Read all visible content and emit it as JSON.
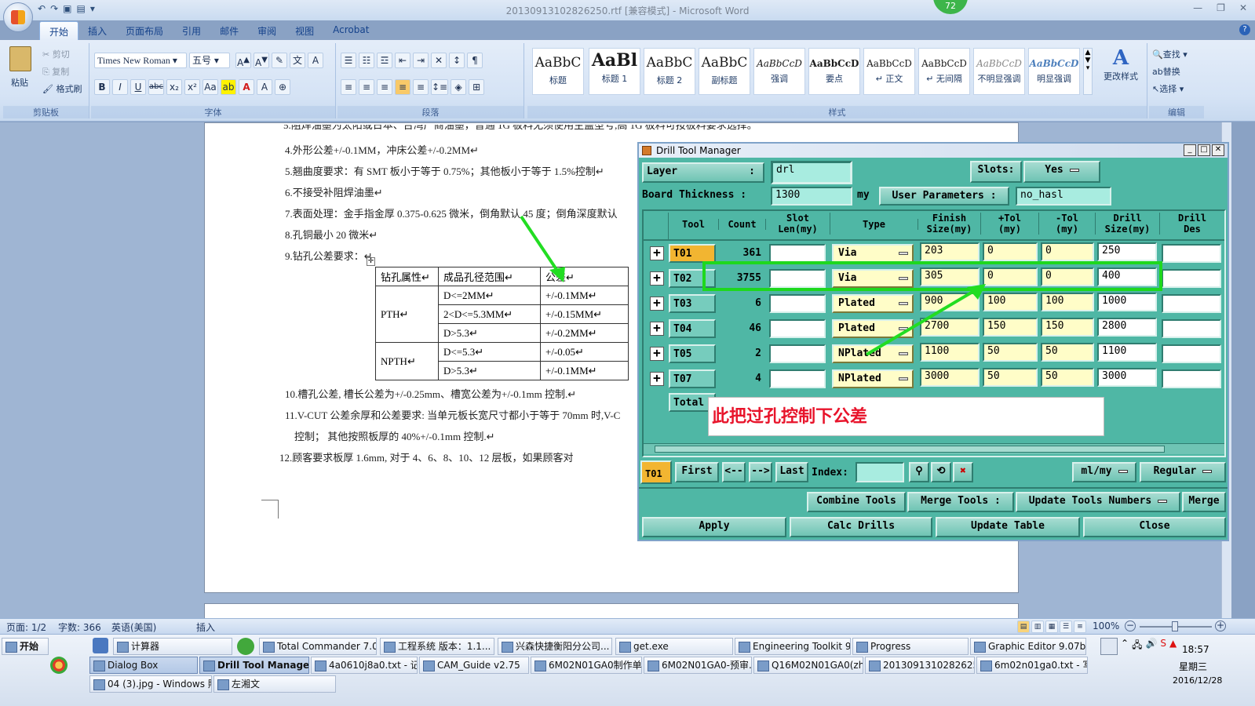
{
  "word": {
    "title": "20130913102826250.rtf [兼容模式] - Microsoft Word",
    "badge": "72",
    "tabs": [
      "开始",
      "插入",
      "页面布局",
      "引用",
      "邮件",
      "审阅",
      "视图",
      "Acrobat"
    ],
    "clipboard": {
      "paste": "粘贴",
      "cut": "剪切",
      "copy": "复制",
      "format_painter": "格式刷",
      "label": "剪贴板"
    },
    "font": {
      "name": "Times New Roman",
      "size": "五号",
      "label": "字体"
    },
    "paragraph_label": "段落",
    "styles": [
      {
        "sample": "AaBbC",
        "name": "标题"
      },
      {
        "sample": "AaBl",
        "name": "标题 1"
      },
      {
        "sample": "AaBbC",
        "name": "标题 2"
      },
      {
        "sample": "AaBbC",
        "name": "副标题"
      },
      {
        "sample": "AaBbCcD",
        "name": "强调"
      },
      {
        "sample": "AaBbCcD",
        "name": "要点"
      },
      {
        "sample": "AaBbCcD",
        "name": "↵ 正文"
      },
      {
        "sample": "AaBbCcD",
        "name": "↵ 无间隔"
      },
      {
        "sample": "AaBbCcD",
        "name": "不明显强调"
      },
      {
        "sample": "AaBbCcD",
        "name": "明显强调"
      }
    ],
    "styles_label": "样式",
    "change_styles": "更改样式",
    "edit": {
      "find": "查找",
      "replace": "替换",
      "select": "选择",
      "label": "编辑"
    }
  },
  "document": {
    "lines": [
      "5.阻焊油墨为太阳或日本、台湾产商油墨，普通 1G 板料无须使用主盖型号,高 1G 板料可按板料要求选择。",
      "4.外形公差+/-0.1MM，冲床公差+/-0.2MM↵",
      "5.翘曲度要求：有 SMT 板小于等于 0.75%；其他板小于等于 1.5%控制↵",
      "6.不接受补阻焊油墨↵",
      "7.表面处理：金手指金厚 0.375-0.625 微米，倒角默认 45 度；倒角深度默认",
      "8.孔铜最小 20 微米↵",
      "9.钻孔公差要求：↵",
      "10.槽孔公差, 槽长公差为+/-0.25mm、槽宽公差为+/-0.1mm 控制.↵",
      "11.V-CUT 公差余厚和公差要求: 当单元板长宽尺寸都小于等于 70mm 时,V-C",
      "控制；  其他按照板厚的 40%+/-0.1mm 控制.↵",
      "12.顾客要求板厚  1.6mm,  对于  4、6、8、10、12  层板，如果顾客对"
    ],
    "table": {
      "header": [
        "钻孔属性↵",
        "成品孔径范围↵",
        "公差↵"
      ],
      "pth_label": "PTH↵",
      "npth_label": "NPTH↵",
      "rows": [
        [
          "D<=2MM↵",
          "+/-0.1MM↵"
        ],
        [
          "2<D<=5.3MM↵",
          "+/-0.15MM↵"
        ],
        [
          "D>5.3↵",
          "+/-0.2MM↵"
        ],
        [
          "D<=5.3↵",
          "+/-0.05↵"
        ],
        [
          "D>5.3↵",
          "+/-0.1MM↵"
        ]
      ]
    }
  },
  "status": {
    "page": "页面: 1/2",
    "words": "字数: 366",
    "lang": "英语(美国)",
    "insert": "插入",
    "zoom": "100%"
  },
  "dtm": {
    "title": "Drill Tool Manager",
    "layer_label": "Layer",
    "layer_sep": ":",
    "layer_value": "drl",
    "slots_label": "Slots:",
    "slots_value": "Yes",
    "thickness_label": "Board Thickness :",
    "thickness_value": "1300",
    "thickness_unit": "my",
    "user_params_label": "User Parameters :",
    "user_params_value": "no_hasl",
    "headers": [
      "Tool",
      "Count",
      "Slot\nLen(my)",
      "Type",
      "Finish\nSize(my)",
      "+Tol\n(my)",
      "-Tol\n(my)",
      "Drill\nSize(my)",
      "Drill\nDes"
    ],
    "rows": [
      {
        "tool": "T01",
        "count": "361",
        "type": "Via",
        "finish": "203",
        "ptol": "0",
        "ntol": "0",
        "drill": "250"
      },
      {
        "tool": "T02",
        "count": "3755",
        "type": "Via",
        "finish": "305",
        "ptol": "0",
        "ntol": "0",
        "drill": "400"
      },
      {
        "tool": "T03",
        "count": "6",
        "type": "Plated",
        "finish": "900",
        "ptol": "100",
        "ntol": "100",
        "drill": "1000"
      },
      {
        "tool": "T04",
        "count": "46",
        "type": "Plated",
        "finish": "2700",
        "ptol": "150",
        "ntol": "150",
        "drill": "2800"
      },
      {
        "tool": "T05",
        "count": "2",
        "type": "NPlated",
        "finish": "1100",
        "ptol": "50",
        "ntol": "50",
        "drill": "1100"
      },
      {
        "tool": "T07",
        "count": "4",
        "type": "NPlated",
        "finish": "3000",
        "ptol": "50",
        "ntol": "50",
        "drill": "3000"
      }
    ],
    "total_label": "Total",
    "annotation": "此把过孔控制下公差",
    "nav": {
      "current": "T01",
      "first": "First",
      "prev": "<--",
      "next": "-->",
      "last": "Last",
      "index": "Index:",
      "unit": "ml/my",
      "mode": "Regular"
    },
    "tools_bar": {
      "combine": "Combine Tools",
      "merge_tools": "Merge Tools :",
      "update_numbers": "Update Tools Numbers",
      "merge": "Merge"
    },
    "bottom": {
      "apply": "Apply",
      "calc": "Calc Drills",
      "update": "Update Table",
      "close": "Close"
    }
  },
  "taskbar": {
    "start": "开始",
    "row1": [
      "计算器",
      "Total Commander 7.0 p...",
      "工程系统  版本：1.1...",
      "兴森快捷衡阳分公司...",
      "get.exe",
      "Engineering Toolkit 9.0...",
      "Progress",
      "Graphic Editor 9.07b2 (..."
    ],
    "row2": [
      "Dialog Box",
      "Drill Tool Manager",
      "4a0610j8a0.txt - 记...",
      "CAM_Guide v2.75",
      "6M02N01GA0制作单...",
      "6M02N01GA0-预审...",
      "Q16M02N01GA0(zho...",
      "20130913102826250...",
      "6m02n01ga0.txt - 写..."
    ],
    "row3": [
      "04 (3).jpg - Windows 照...",
      "左湘文"
    ],
    "time": "18:57",
    "day": "星期三",
    "date": "2016/12/28"
  }
}
